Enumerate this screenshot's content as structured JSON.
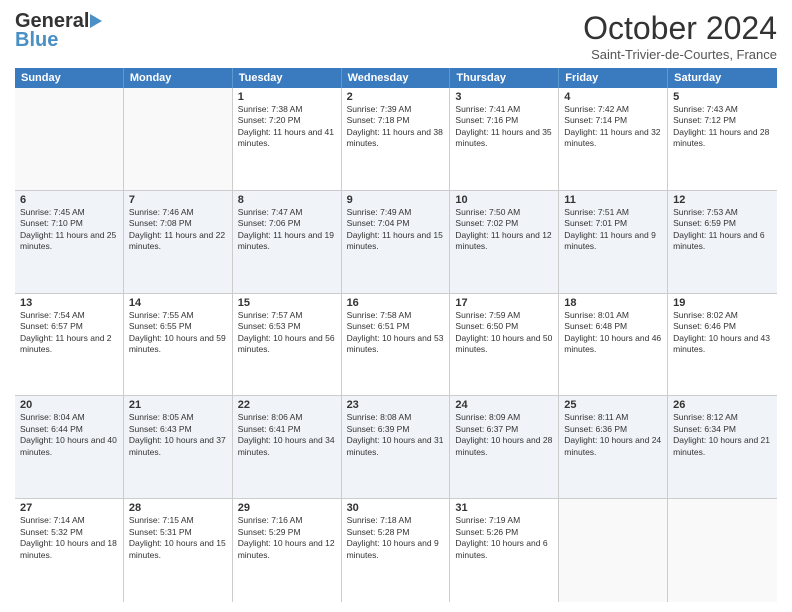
{
  "header": {
    "logo_general": "General",
    "logo_blue": "Blue",
    "month_title": "October 2024",
    "subtitle": "Saint-Trivier-de-Courtes, France"
  },
  "days_of_week": [
    "Sunday",
    "Monday",
    "Tuesday",
    "Wednesday",
    "Thursday",
    "Friday",
    "Saturday"
  ],
  "weeks": [
    [
      {
        "day": "",
        "sunrise": "",
        "sunset": "",
        "daylight": "",
        "empty": true
      },
      {
        "day": "",
        "sunrise": "",
        "sunset": "",
        "daylight": "",
        "empty": true
      },
      {
        "day": "1",
        "sunrise": "Sunrise: 7:38 AM",
        "sunset": "Sunset: 7:20 PM",
        "daylight": "Daylight: 11 hours and 41 minutes."
      },
      {
        "day": "2",
        "sunrise": "Sunrise: 7:39 AM",
        "sunset": "Sunset: 7:18 PM",
        "daylight": "Daylight: 11 hours and 38 minutes."
      },
      {
        "day": "3",
        "sunrise": "Sunrise: 7:41 AM",
        "sunset": "Sunset: 7:16 PM",
        "daylight": "Daylight: 11 hours and 35 minutes."
      },
      {
        "day": "4",
        "sunrise": "Sunrise: 7:42 AM",
        "sunset": "Sunset: 7:14 PM",
        "daylight": "Daylight: 11 hours and 32 minutes."
      },
      {
        "day": "5",
        "sunrise": "Sunrise: 7:43 AM",
        "sunset": "Sunset: 7:12 PM",
        "daylight": "Daylight: 11 hours and 28 minutes."
      }
    ],
    [
      {
        "day": "6",
        "sunrise": "Sunrise: 7:45 AM",
        "sunset": "Sunset: 7:10 PM",
        "daylight": "Daylight: 11 hours and 25 minutes."
      },
      {
        "day": "7",
        "sunrise": "Sunrise: 7:46 AM",
        "sunset": "Sunset: 7:08 PM",
        "daylight": "Daylight: 11 hours and 22 minutes."
      },
      {
        "day": "8",
        "sunrise": "Sunrise: 7:47 AM",
        "sunset": "Sunset: 7:06 PM",
        "daylight": "Daylight: 11 hours and 19 minutes."
      },
      {
        "day": "9",
        "sunrise": "Sunrise: 7:49 AM",
        "sunset": "Sunset: 7:04 PM",
        "daylight": "Daylight: 11 hours and 15 minutes."
      },
      {
        "day": "10",
        "sunrise": "Sunrise: 7:50 AM",
        "sunset": "Sunset: 7:02 PM",
        "daylight": "Daylight: 11 hours and 12 minutes."
      },
      {
        "day": "11",
        "sunrise": "Sunrise: 7:51 AM",
        "sunset": "Sunset: 7:01 PM",
        "daylight": "Daylight: 11 hours and 9 minutes."
      },
      {
        "day": "12",
        "sunrise": "Sunrise: 7:53 AM",
        "sunset": "Sunset: 6:59 PM",
        "daylight": "Daylight: 11 hours and 6 minutes."
      }
    ],
    [
      {
        "day": "13",
        "sunrise": "Sunrise: 7:54 AM",
        "sunset": "Sunset: 6:57 PM",
        "daylight": "Daylight: 11 hours and 2 minutes."
      },
      {
        "day": "14",
        "sunrise": "Sunrise: 7:55 AM",
        "sunset": "Sunset: 6:55 PM",
        "daylight": "Daylight: 10 hours and 59 minutes."
      },
      {
        "day": "15",
        "sunrise": "Sunrise: 7:57 AM",
        "sunset": "Sunset: 6:53 PM",
        "daylight": "Daylight: 10 hours and 56 minutes."
      },
      {
        "day": "16",
        "sunrise": "Sunrise: 7:58 AM",
        "sunset": "Sunset: 6:51 PM",
        "daylight": "Daylight: 10 hours and 53 minutes."
      },
      {
        "day": "17",
        "sunrise": "Sunrise: 7:59 AM",
        "sunset": "Sunset: 6:50 PM",
        "daylight": "Daylight: 10 hours and 50 minutes."
      },
      {
        "day": "18",
        "sunrise": "Sunrise: 8:01 AM",
        "sunset": "Sunset: 6:48 PM",
        "daylight": "Daylight: 10 hours and 46 minutes."
      },
      {
        "day": "19",
        "sunrise": "Sunrise: 8:02 AM",
        "sunset": "Sunset: 6:46 PM",
        "daylight": "Daylight: 10 hours and 43 minutes."
      }
    ],
    [
      {
        "day": "20",
        "sunrise": "Sunrise: 8:04 AM",
        "sunset": "Sunset: 6:44 PM",
        "daylight": "Daylight: 10 hours and 40 minutes."
      },
      {
        "day": "21",
        "sunrise": "Sunrise: 8:05 AM",
        "sunset": "Sunset: 6:43 PM",
        "daylight": "Daylight: 10 hours and 37 minutes."
      },
      {
        "day": "22",
        "sunrise": "Sunrise: 8:06 AM",
        "sunset": "Sunset: 6:41 PM",
        "daylight": "Daylight: 10 hours and 34 minutes."
      },
      {
        "day": "23",
        "sunrise": "Sunrise: 8:08 AM",
        "sunset": "Sunset: 6:39 PM",
        "daylight": "Daylight: 10 hours and 31 minutes."
      },
      {
        "day": "24",
        "sunrise": "Sunrise: 8:09 AM",
        "sunset": "Sunset: 6:37 PM",
        "daylight": "Daylight: 10 hours and 28 minutes."
      },
      {
        "day": "25",
        "sunrise": "Sunrise: 8:11 AM",
        "sunset": "Sunset: 6:36 PM",
        "daylight": "Daylight: 10 hours and 24 minutes."
      },
      {
        "day": "26",
        "sunrise": "Sunrise: 8:12 AM",
        "sunset": "Sunset: 6:34 PM",
        "daylight": "Daylight: 10 hours and 21 minutes."
      }
    ],
    [
      {
        "day": "27",
        "sunrise": "Sunrise: 7:14 AM",
        "sunset": "Sunset: 5:32 PM",
        "daylight": "Daylight: 10 hours and 18 minutes."
      },
      {
        "day": "28",
        "sunrise": "Sunrise: 7:15 AM",
        "sunset": "Sunset: 5:31 PM",
        "daylight": "Daylight: 10 hours and 15 minutes."
      },
      {
        "day": "29",
        "sunrise": "Sunrise: 7:16 AM",
        "sunset": "Sunset: 5:29 PM",
        "daylight": "Daylight: 10 hours and 12 minutes."
      },
      {
        "day": "30",
        "sunrise": "Sunrise: 7:18 AM",
        "sunset": "Sunset: 5:28 PM",
        "daylight": "Daylight: 10 hours and 9 minutes."
      },
      {
        "day": "31",
        "sunrise": "Sunrise: 7:19 AM",
        "sunset": "Sunset: 5:26 PM",
        "daylight": "Daylight: 10 hours and 6 minutes."
      },
      {
        "day": "",
        "sunrise": "",
        "sunset": "",
        "daylight": "",
        "empty": true
      },
      {
        "day": "",
        "sunrise": "",
        "sunset": "",
        "daylight": "",
        "empty": true
      }
    ]
  ]
}
